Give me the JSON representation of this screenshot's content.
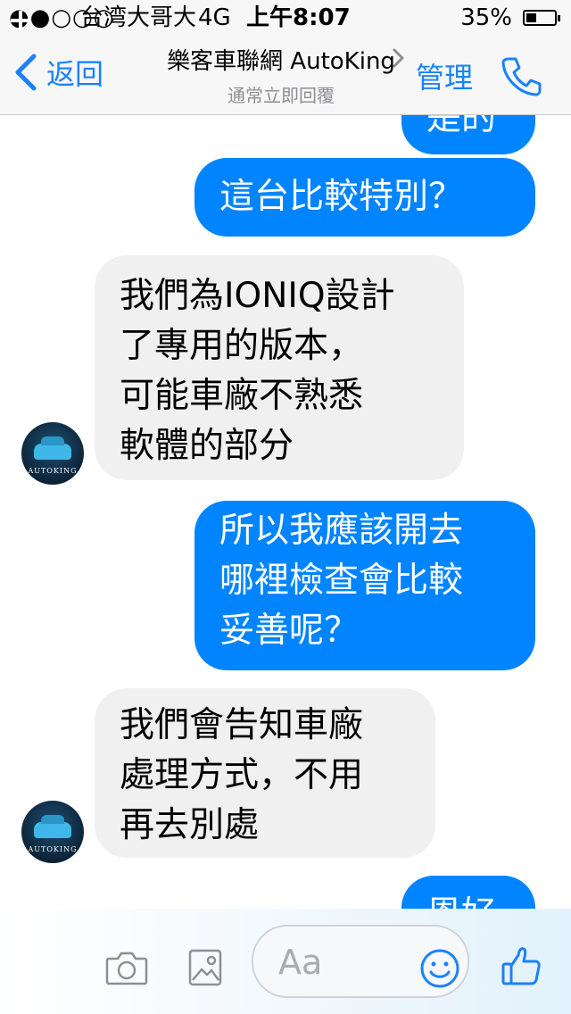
{
  "status_bar": {
    "signal": "●●○○○",
    "carrier": "台湾大哥大",
    "network": "4G",
    "time": "上午8:07",
    "battery_percent": "35%",
    "battery_level": 0.35
  },
  "nav": {
    "back_label": "返回",
    "title": "樂客車聯網 AutoKing",
    "subtitle": "通常立即回覆",
    "manage_label": "管理"
  },
  "messages": [
    {
      "side": "out",
      "text": "是的"
    },
    {
      "side": "out",
      "text": "這台比較特別？"
    },
    {
      "side": "in",
      "lines": [
        "我們為IONIQ設計",
        "了專用的版本，",
        "可能車廠不熟悉",
        "軟體的部分"
      ],
      "avatar_text": "AUTOKING"
    },
    {
      "side": "out",
      "lines": [
        "所以我應該開去",
        "哪裡檢查會比較",
        "妥善呢？"
      ]
    },
    {
      "side": "in",
      "lines": [
        "我們會告知車廠",
        "處理方式，不用",
        "再去別處"
      ],
      "avatar_text": "AUTOKING"
    },
    {
      "side": "out",
      "text": "恩好"
    }
  ],
  "composer": {
    "placeholder": "Aa"
  },
  "colors": {
    "accent": "#1a82fb",
    "outgoing_bubble": "#0084ff",
    "incoming_bubble": "#f1f0f0"
  },
  "icons": [
    "back-chevron-icon",
    "chevron-right-icon",
    "phone-icon",
    "plus-icon",
    "camera-icon",
    "image-icon",
    "smiley-icon",
    "thumbs-up-icon"
  ]
}
